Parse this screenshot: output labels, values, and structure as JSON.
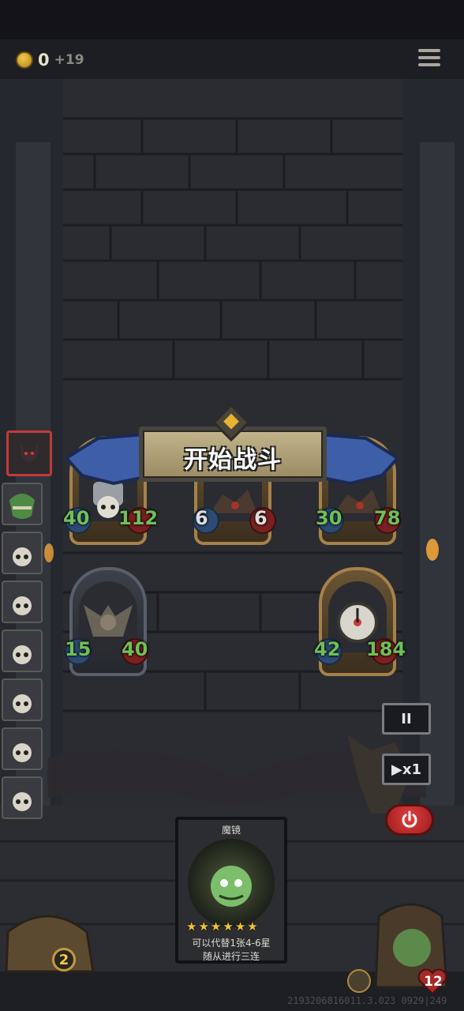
{
  "topbar": {
    "coins": "0",
    "coin_bonus": "+19"
  },
  "banner": {
    "title": "开始战斗"
  },
  "enemy_row1": [
    {
      "atk": "40",
      "hp": "112"
    },
    {
      "atk": "6",
      "hp": "6"
    },
    {
      "atk": "30",
      "hp": "78"
    }
  ],
  "enemy_row2": [
    {
      "atk": "15",
      "hp": "40"
    },
    {
      "atk": "42",
      "hp": "184"
    }
  ],
  "controls": {
    "pause": "II",
    "speed": "▶x1"
  },
  "card": {
    "title": "魔镜",
    "stars": 6,
    "desc_line1": "可以代替1张4-6星",
    "desc_line2": "随从进行三连"
  },
  "chest": {
    "count": "2"
  },
  "hero": {
    "hp": "12"
  },
  "version": "2193206816011.3.023 0929|249"
}
